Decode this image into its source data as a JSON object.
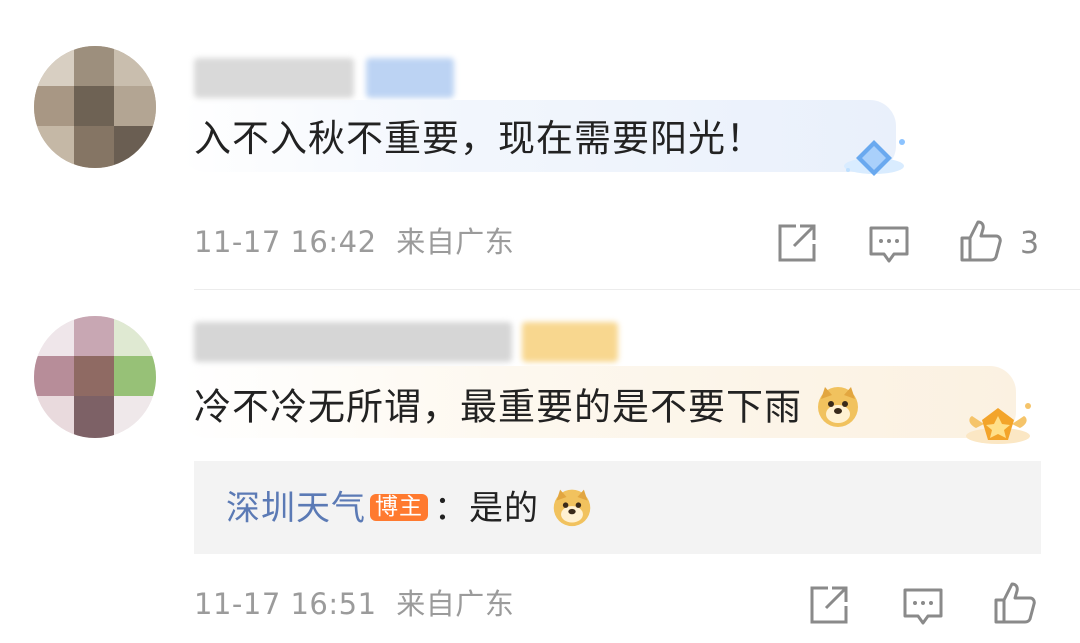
{
  "comments": [
    {
      "text": "入不入秋不重要，现在需要阳光！",
      "timestamp": "11-17 16:42",
      "location": "来自广东",
      "like_count": "3",
      "badge_icon": "blue-diamond-badge-icon"
    },
    {
      "text": "冷不冷无所谓，最重要的是不要下雨",
      "timestamp": "11-17 16:51",
      "location": "来自广东",
      "like_count": "",
      "badge_icon": "gold-star-badge-icon",
      "reply": {
        "author": "深圳天气",
        "tag": "博主",
        "text": "：是的"
      }
    }
  ],
  "colors": {
    "reply_name": "#5b7ab5",
    "tag_bg": "#ff7a2f",
    "meta_text": "#9b9b9b",
    "reply_box_bg": "#f3f3f3"
  },
  "icons": [
    "share-icon",
    "comment-icon",
    "like-icon",
    "doge-emoji-icon"
  ]
}
